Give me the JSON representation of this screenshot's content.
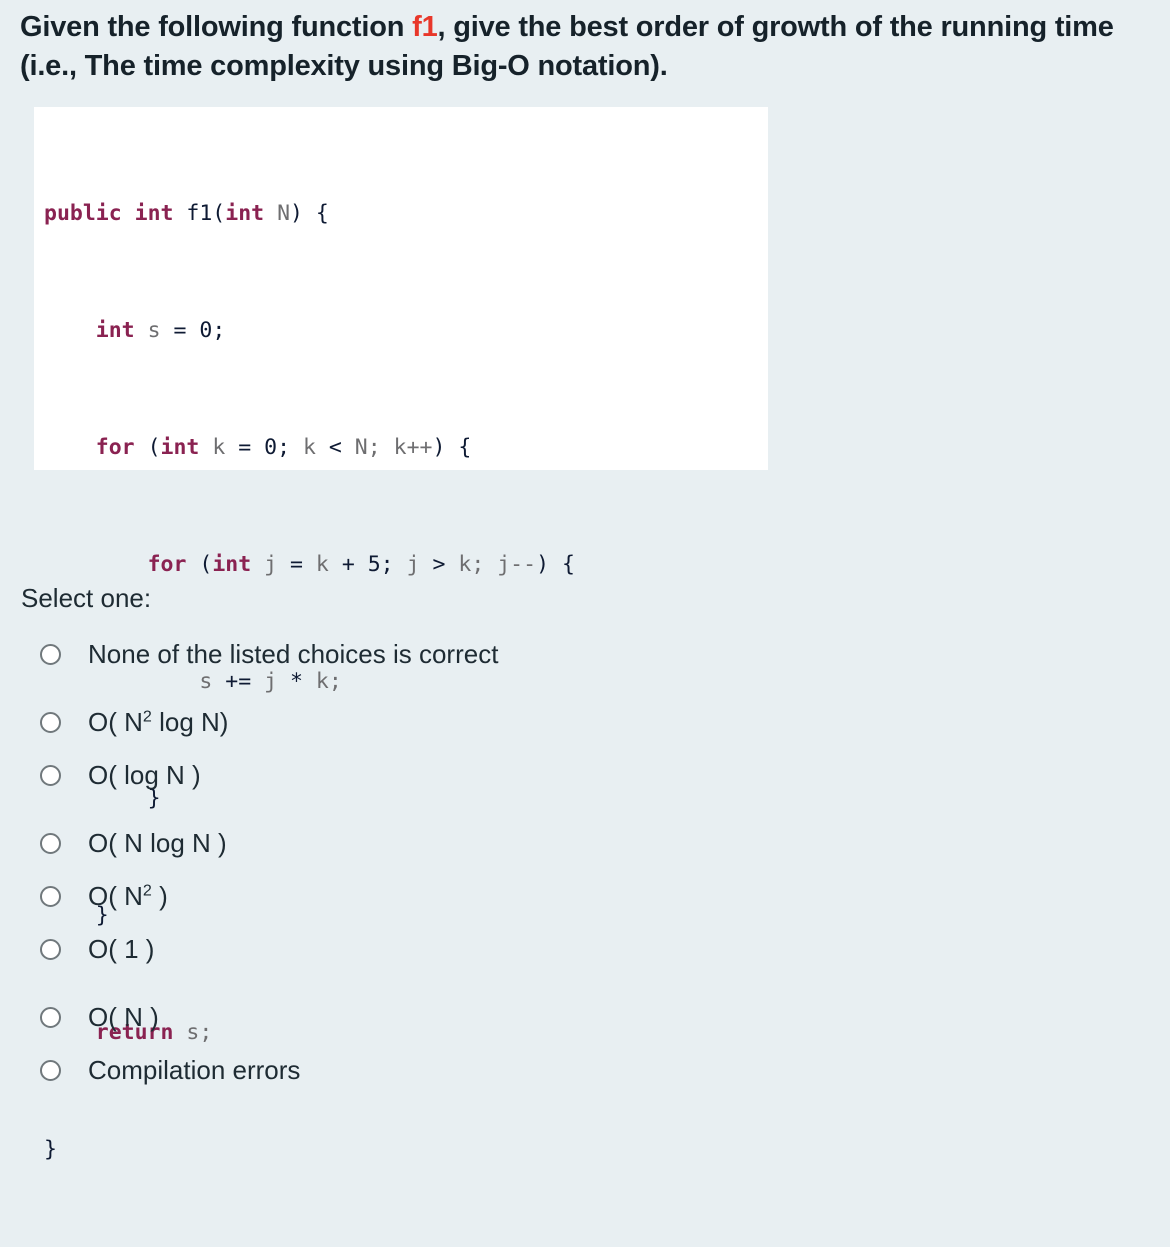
{
  "question": {
    "text_before_fn": "Given the following function ",
    "fn_name": "f1",
    "text_after_fn": ", give the best order of growth of the running time (i.e., The time complexity using Big-O notation)."
  },
  "code": {
    "language": "java",
    "lines": [
      "public int f1(int N) {",
      "    int s = 0;",
      "    for (int k = 0; k < N; k++) {",
      "        for (int j = k + 5; j > k; j--) {",
      "            s += j * k;",
      "        }",
      "    }",
      "    return s;",
      "}"
    ]
  },
  "prompt": {
    "select_one_label": "Select one:"
  },
  "options": [
    {
      "id": "opt-none",
      "label": "None of the listed choices is correct",
      "base": "None of the listed choices is correct",
      "sup": "",
      "tail": ""
    },
    {
      "id": "opt-n2-log-n",
      "label": "O( N2 log N)",
      "base": "O( N",
      "sup": "2",
      "tail": " log N)"
    },
    {
      "id": "opt-log-n",
      "label": "O( log N )",
      "base": "O( log N )",
      "sup": "",
      "tail": ""
    },
    {
      "id": "opt-n-log-n",
      "label": "O( N log N )",
      "base": "O( N log N )",
      "sup": "",
      "tail": ""
    },
    {
      "id": "opt-n2",
      "label": "O( N2 )",
      "base": "O( N",
      "sup": "2",
      "tail": " )"
    },
    {
      "id": "opt-1",
      "label": "O( 1 )",
      "base": "O( 1 )",
      "sup": "",
      "tail": ""
    },
    {
      "id": "opt-n",
      "label": "O( N )",
      "base": "O( N )",
      "sup": "",
      "tail": ""
    },
    {
      "id": "opt-compile",
      "label": "Compilation errors",
      "base": "Compilation errors",
      "sup": "",
      "tail": ""
    }
  ],
  "colors": {
    "page_background": "#e8eff2",
    "code_background": "#ffffff",
    "heading_text": "#16222a",
    "function_name_accent": "#e8372a",
    "code_keyword": "#8a2251",
    "code_identifier": "#6e6e70",
    "code_default": "#0e1a33",
    "radio_border": "#70787c",
    "option_text": "#1e2b33"
  }
}
